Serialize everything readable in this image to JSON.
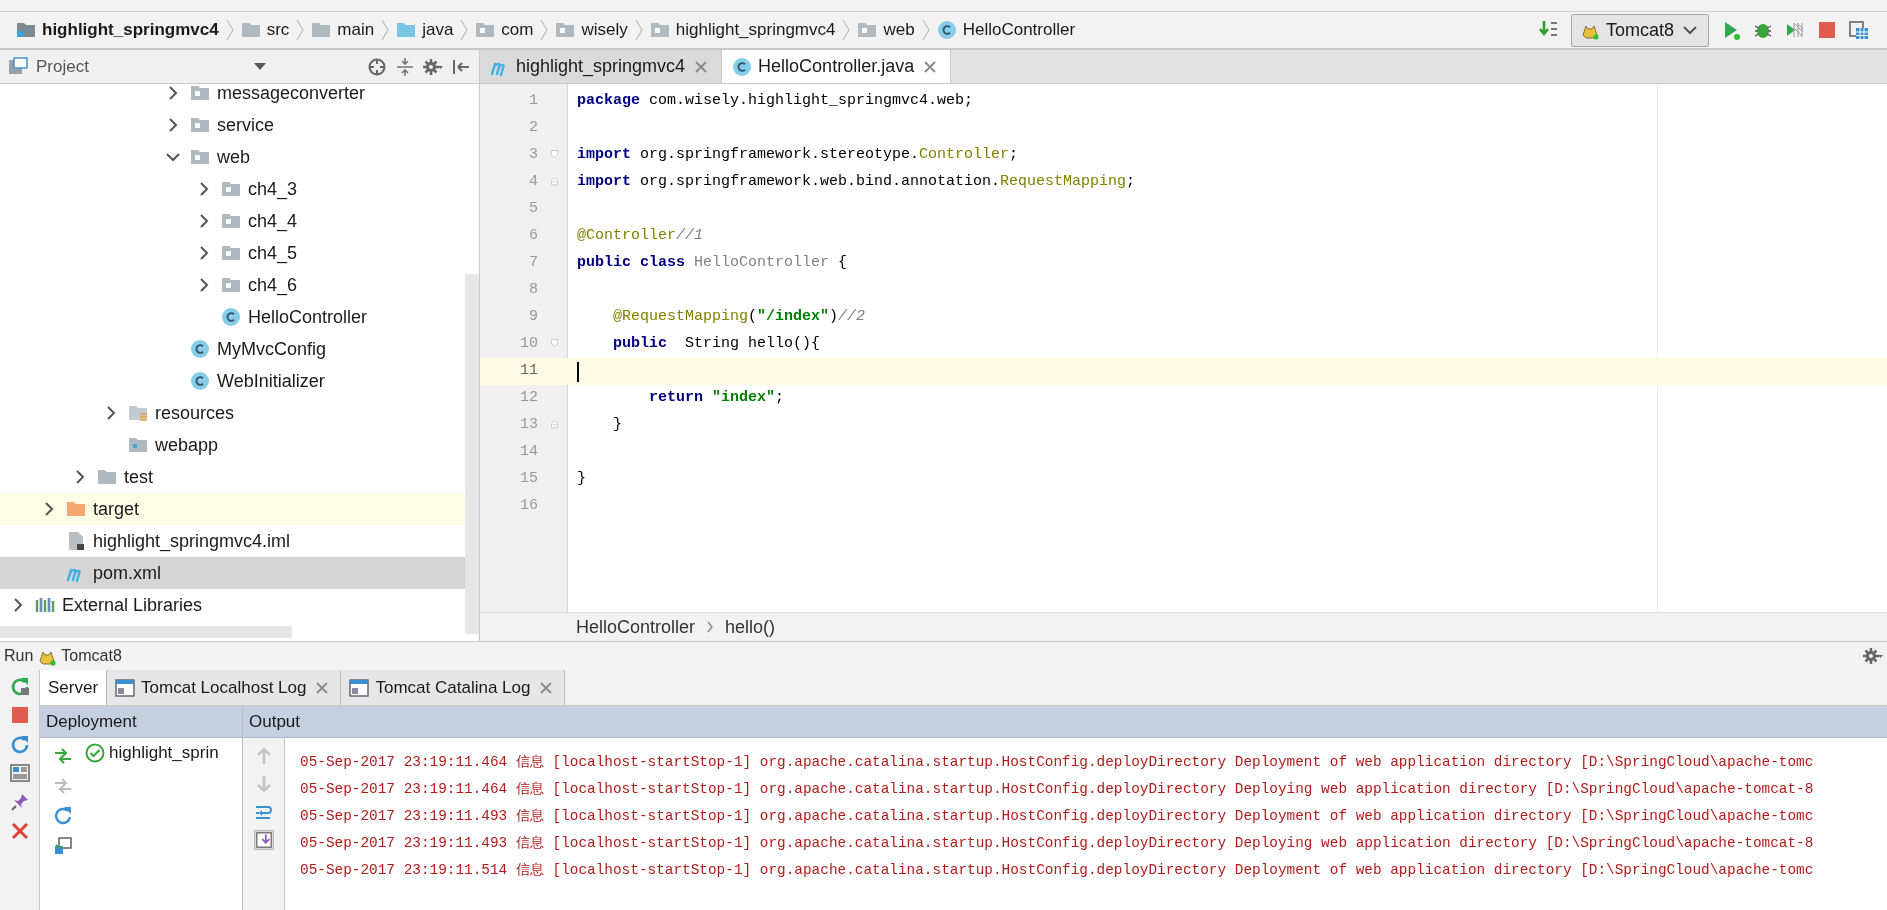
{
  "nav_bar": {
    "breadcrumbs": [
      {
        "label": "highlight_springmvc4",
        "kind": "module"
      },
      {
        "label": "src",
        "kind": "folder"
      },
      {
        "label": "main",
        "kind": "folder"
      },
      {
        "label": "java",
        "kind": "source-folder"
      },
      {
        "label": "com",
        "kind": "package"
      },
      {
        "label": "wisely",
        "kind": "package"
      },
      {
        "label": "highlight_springmvc4",
        "kind": "package"
      },
      {
        "label": "web",
        "kind": "package"
      },
      {
        "label": "HelloController",
        "kind": "class"
      }
    ],
    "run_config": {
      "label": "Tomcat8"
    }
  },
  "project_panel": {
    "title": "Project",
    "tree": [
      {
        "children": [
          {
            "children": [
              {
                "children": [
                  {
                    "children": [
                      {
                        "children": [
                          {
                            "label": "messageconverter",
                            "kind": "package",
                            "expanded": false,
                            "selected": false
                          },
                          {
                            "label": "service",
                            "kind": "package",
                            "expanded": false,
                            "selected": false
                          },
                          {
                            "label": "web",
                            "kind": "package",
                            "expanded": true,
                            "selected": false,
                            "children": [
                              {
                                "label": "ch4_3",
                                "kind": "package",
                                "expanded": false,
                                "selected": false
                              },
                              {
                                "label": "ch4_4",
                                "kind": "package",
                                "expanded": false,
                                "selected": false
                              },
                              {
                                "label": "ch4_5",
                                "kind": "package",
                                "expanded": false,
                                "selected": false
                              },
                              {
                                "label": "ch4_6",
                                "kind": "package",
                                "expanded": false,
                                "selected": false
                              },
                              {
                                "label": "HelloController",
                                "kind": "class",
                                "selected": false
                              }
                            ]
                          },
                          {
                            "label": "MyMvcConfig",
                            "kind": "class",
                            "selected": false
                          },
                          {
                            "label": "WebInitializer",
                            "kind": "class",
                            "selected": false
                          }
                        ]
                      }
                    ]
                  },
                  {
                    "label": "resources",
                    "kind": "resource-folder",
                    "expanded": false,
                    "selected": false
                  },
                  {
                    "label": "webapp",
                    "kind": "web-folder",
                    "selected": false
                  }
                ]
              },
              {
                "label": "test",
                "kind": "folder",
                "expanded": false,
                "selected": false
              }
            ]
          },
          {
            "label": "target",
            "kind": "excluded-folder",
            "expanded": false,
            "selected": false
          },
          {
            "label": "highlight_springmvc4.iml",
            "kind": "module-file",
            "selected": false
          },
          {
            "label": "pom.xml",
            "kind": "maven-file",
            "selected": true
          }
        ]
      },
      {
        "label": "External Libraries",
        "kind": "library",
        "expanded": false,
        "selected": false
      }
    ]
  },
  "editor": {
    "tabs": [
      {
        "label": "highlight_springmvc4",
        "kind": "maven",
        "selected": false
      },
      {
        "label": "HelloController.java",
        "kind": "class",
        "selected": true
      }
    ],
    "lines": [
      {
        "number": "1",
        "current": false,
        "tokens": [
          {
            "kind": "keyword",
            "text": "package"
          },
          {
            "kind": "plain",
            "text": " com.wisely.highlight_springmvc4.web;"
          }
        ]
      },
      {
        "number": "2",
        "current": false
      },
      {
        "number": "3",
        "current": false,
        "fold_marker": {
          "kind": "start"
        },
        "tokens": [
          {
            "kind": "keyword",
            "text": "import"
          },
          {
            "kind": "plain",
            "text": " org.springframework.stereotype."
          },
          {
            "kind": "reference",
            "text": "Controller"
          },
          {
            "kind": "plain",
            "text": ";"
          }
        ]
      },
      {
        "number": "4",
        "current": false,
        "fold_marker": {
          "kind": "end"
        },
        "tokens": [
          {
            "kind": "keyword",
            "text": "import"
          },
          {
            "kind": "plain",
            "text": " org.springframework.web.bind.annotation."
          },
          {
            "kind": "reference",
            "text": "RequestMapping"
          },
          {
            "kind": "plain",
            "text": ";"
          }
        ]
      },
      {
        "number": "5",
        "current": false
      },
      {
        "number": "6",
        "current": false,
        "tokens": [
          {
            "kind": "annotation",
            "text": "@Controller"
          },
          {
            "kind": "comment",
            "text": "//1"
          }
        ]
      },
      {
        "number": "7",
        "current": false,
        "tokens": [
          {
            "kind": "keyword",
            "text": "public class"
          },
          {
            "kind": "unused",
            "text": " HelloController"
          },
          {
            "kind": "plain",
            "text": " {"
          }
        ]
      },
      {
        "number": "8",
        "current": false
      },
      {
        "number": "9",
        "current": false,
        "tokens": [
          {
            "kind": "annotation",
            "text": "    @RequestMapping"
          },
          {
            "kind": "plain",
            "text": "("
          },
          {
            "kind": "string",
            "text": "\"/index\""
          },
          {
            "kind": "plain",
            "text": ")"
          },
          {
            "kind": "comment",
            "text": "//2"
          }
        ]
      },
      {
        "number": "10",
        "current": false,
        "fold_marker": {
          "kind": "start"
        },
        "tokens": [
          {
            "kind": "keyword",
            "text": "    public"
          },
          {
            "kind": "plain",
            "text": "  String hello(){"
          }
        ]
      },
      {
        "number": "11",
        "current": true
      },
      {
        "number": "12",
        "current": false,
        "tokens": [
          {
            "kind": "keyword",
            "text": "        return"
          },
          {
            "kind": "string",
            "text": " \"index\""
          },
          {
            "kind": "plain",
            "text": ";"
          }
        ]
      },
      {
        "number": "13",
        "current": false,
        "fold_marker": {
          "kind": "end"
        },
        "tokens": [
          {
            "kind": "plain",
            "text": "    }"
          }
        ]
      },
      {
        "number": "14",
        "current": false
      },
      {
        "number": "15",
        "current": false,
        "tokens": [
          {
            "kind": "plain",
            "text": "}"
          }
        ]
      },
      {
        "number": "16",
        "current": false
      }
    ],
    "breadcrumbs": [
      "HelloController",
      "hello()"
    ]
  },
  "run_panel": {
    "title": "Run",
    "config": "Tomcat8",
    "tabs": [
      {
        "label": "Server",
        "kind": "plain",
        "selected": true
      },
      {
        "label": "Tomcat Localhost Log",
        "kind": "log",
        "selected": false
      },
      {
        "label": "Tomcat Catalina Log",
        "kind": "log",
        "selected": false
      }
    ],
    "deployment_header": "Deployment",
    "output_header": "Output",
    "deployments": [
      {
        "label": "highlight_sprin",
        "running": true
      }
    ],
    "log_lines": [
      "05-Sep-2017 23:19:11.464 信息 [localhost-startStop-1] org.apache.catalina.startup.HostConfig.deployDirectory Deployment of web application directory [D:\\SpringCloud\\apache-tomc",
      "05-Sep-2017 23:19:11.464 信息 [localhost-startStop-1] org.apache.catalina.startup.HostConfig.deployDirectory Deploying web application directory [D:\\SpringCloud\\apache-tomcat-8",
      "05-Sep-2017 23:19:11.493 信息 [localhost-startStop-1] org.apache.catalina.startup.HostConfig.deployDirectory Deployment of web application directory [D:\\SpringCloud\\apache-tomc",
      "05-Sep-2017 23:19:11.493 信息 [localhost-startStop-1] org.apache.catalina.startup.HostConfig.deployDirectory Deploying web application directory [D:\\SpringCloud\\apache-tomcat-8",
      "05-Sep-2017 23:19:11.514 信息 [localhost-startStop-1] org.apache.catalina.startup.HostConfig.deployDirectory Deployment of web application directory [D:\\SpringCloud\\apache-tomc"
    ]
  }
}
